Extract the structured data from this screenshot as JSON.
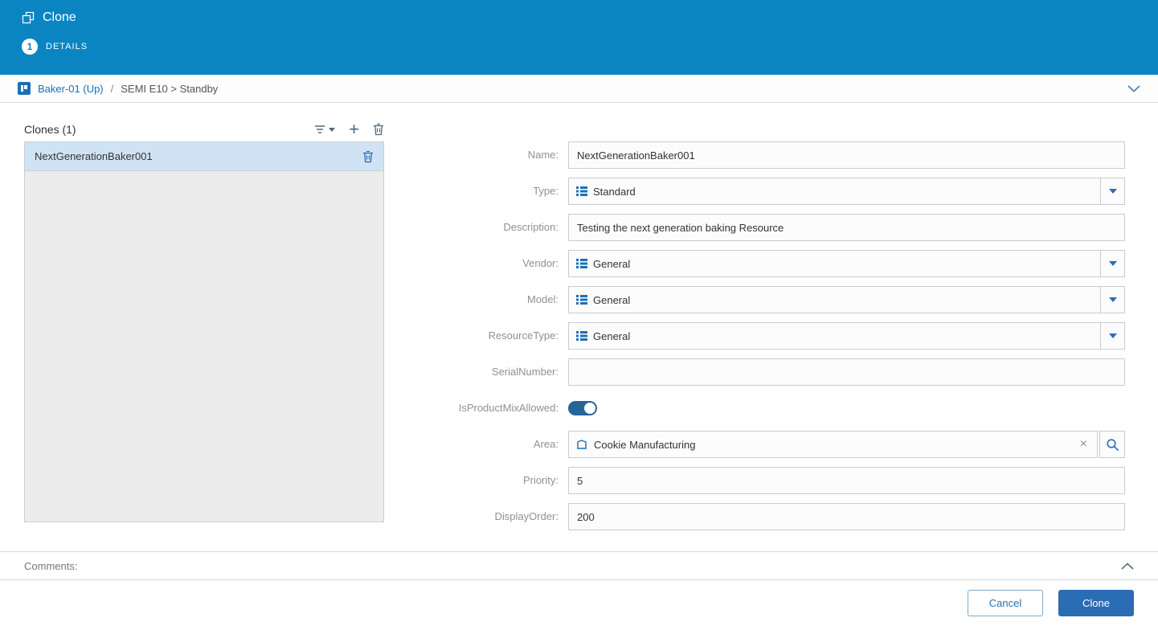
{
  "colors": {
    "header_bg": "#0b85c2",
    "accent_blue": "#2a6db4",
    "link_blue": "#1d6fb5",
    "selected_row_bg": "#cfe3f4",
    "toggle_on": "#24659c"
  },
  "header": {
    "title": "Clone",
    "step_number": "1",
    "step_label": "DETAILS"
  },
  "breadcrumb": {
    "entity": "Baker-01 (Up)",
    "separator": "/",
    "state_path": "SEMI E10 > Standby"
  },
  "clones_panel": {
    "title": "Clones (1)",
    "items": [
      {
        "name": "NextGenerationBaker001"
      }
    ]
  },
  "form": {
    "name": {
      "label": "Name:",
      "value": "NextGenerationBaker001"
    },
    "type": {
      "label": "Type:",
      "value": "Standard"
    },
    "description": {
      "label": "Description:",
      "value": "Testing the next generation baking Resource"
    },
    "vendor": {
      "label": "Vendor:",
      "value": "General"
    },
    "model": {
      "label": "Model:",
      "value": "General"
    },
    "resource_type": {
      "label": "ResourceType:",
      "value": "General"
    },
    "serial_number": {
      "label": "SerialNumber:",
      "value": ""
    },
    "is_product_mix_allowed": {
      "label": "IsProductMixAllowed:",
      "state": "on"
    },
    "area": {
      "label": "Area:",
      "value": "Cookie Manufacturing"
    },
    "priority": {
      "label": "Priority:",
      "value": "5"
    },
    "display_order": {
      "label": "DisplayOrder:",
      "value": "200"
    }
  },
  "comments": {
    "label": "Comments:"
  },
  "footer": {
    "cancel_label": "Cancel",
    "clone_label": "Clone"
  },
  "glyphs": {
    "plus": "+",
    "clear": "×"
  }
}
